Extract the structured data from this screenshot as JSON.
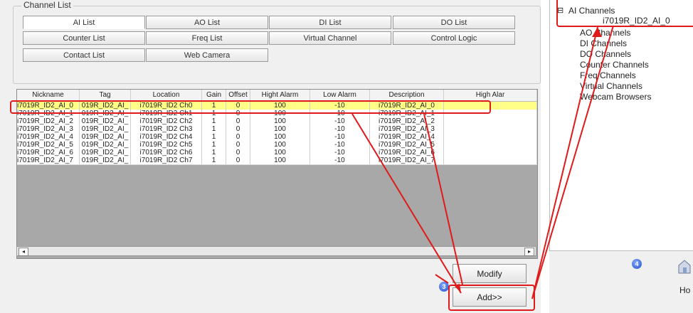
{
  "group_title": "Channel List",
  "tabs": [
    {
      "label": "AI List",
      "active": true
    },
    {
      "label": "AO List",
      "active": false
    },
    {
      "label": "DI List",
      "active": false
    },
    {
      "label": "DO List",
      "active": false
    },
    {
      "label": "Counter List",
      "active": false
    },
    {
      "label": "Freq List",
      "active": false
    },
    {
      "label": "Virtual Channel",
      "active": false
    },
    {
      "label": "Control Logic",
      "active": false
    },
    {
      "label": "Contact List",
      "active": false
    },
    {
      "label": "Web Camera",
      "active": false
    }
  ],
  "table": {
    "headers": [
      "Nickname",
      "Tag",
      "Location",
      "Gain",
      "Offset",
      "Hight Alarm",
      "Low Alarm",
      "Description",
      "High Alar"
    ],
    "rows": [
      [
        "i7019R_ID2_AI_0",
        "019R_ID2_AI_",
        "i7019R_ID2 Ch0",
        "1",
        "0",
        "100",
        "-10",
        "i7019R_ID2_AI_0",
        ""
      ],
      [
        "i7019R_ID2_AI_1",
        "019R_ID2_AI_",
        "i7019R_ID2 Ch1",
        "1",
        "0",
        "100",
        "-10",
        "i7019R_ID2_AI_1",
        ""
      ],
      [
        "i7019R_ID2_AI_2",
        "019R_ID2_AI_",
        "i7019R_ID2 Ch2",
        "1",
        "0",
        "100",
        "-10",
        "i7019R_ID2_AI_2",
        ""
      ],
      [
        "i7019R_ID2_AI_3",
        "019R_ID2_AI_",
        "i7019R_ID2 Ch3",
        "1",
        "0",
        "100",
        "-10",
        "i7019R_ID2_AI_3",
        ""
      ],
      [
        "i7019R_ID2_AI_4",
        "019R_ID2_AI_",
        "i7019R_ID2 Ch4",
        "1",
        "0",
        "100",
        "-10",
        "i7019R_ID2_AI_4",
        ""
      ],
      [
        "i7019R_ID2_AI_5",
        "019R_ID2_AI_",
        "i7019R_ID2 Ch5",
        "1",
        "0",
        "100",
        "-10",
        "i7019R_ID2_AI_5",
        ""
      ],
      [
        "i7019R_ID2_AI_6",
        "019R_ID2_AI_",
        "i7019R_ID2 Ch6",
        "1",
        "0",
        "100",
        "-10",
        "i7019R_ID2_AI_6",
        ""
      ],
      [
        "i7019R_ID2_AI_7",
        "019R_ID2_AI_",
        "i7019R_ID2 Ch7",
        "1",
        "0",
        "100",
        "-10",
        "i7019R_ID2_AI_7",
        ""
      ]
    ],
    "selected_row": 0
  },
  "buttons": {
    "modify": "Modify",
    "add": "Add>>",
    "home_partial": "Ho"
  },
  "step_markers": {
    "three": "3",
    "four": "4"
  },
  "tree": {
    "expander": "⊟",
    "ai_channels": "AI Channels",
    "ai_child": "i7019R_ID2_AI_0",
    "others": [
      "AO Channels",
      "DI Channels",
      "DO Channels",
      "Counter Channels",
      "Freq Channels",
      "Virtual Channels",
      "Webcam Browsers"
    ]
  },
  "colors": {
    "selected_row": "#ffff88",
    "annotation_red": "#e01a1a",
    "grid_empty": "#a8a8a8"
  }
}
